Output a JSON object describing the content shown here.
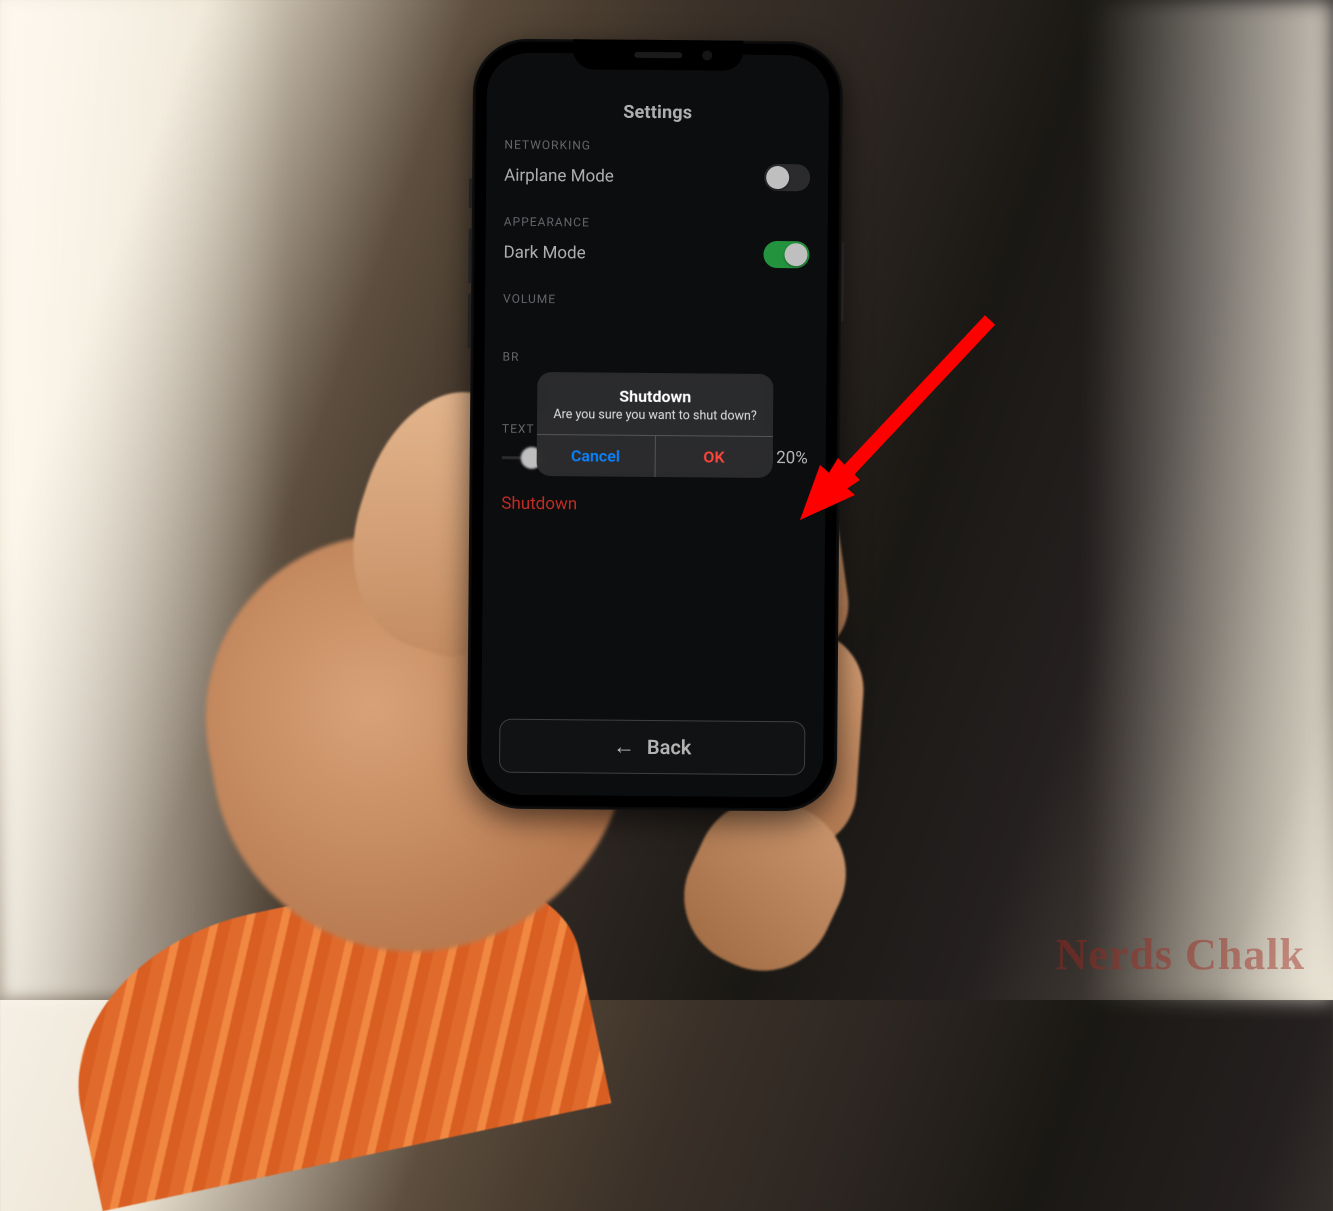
{
  "page_title": "Settings",
  "sections": {
    "networking": {
      "label": "NETWORKING",
      "item_label": "Airplane Mode",
      "toggle_on": false
    },
    "appearance": {
      "label": "APPEARANCE",
      "item_label": "Dark Mode",
      "toggle_on": true
    },
    "volume": {
      "label": "VOLUME"
    },
    "brightness": {
      "label_abbrev": "BR"
    },
    "text_size": {
      "label": "TEXT SIZE",
      "value_display": "120%",
      "slider_position_pct": 12
    }
  },
  "shutdown_link": "Shutdown",
  "back_button": "Back",
  "alert": {
    "title": "Shutdown",
    "message": "Are you sure you want to shut down?",
    "cancel": "Cancel",
    "ok": "OK"
  },
  "watermark": "Nerds Chalk",
  "colors": {
    "accent_blue": "#0a84ff",
    "destructive_red": "#ff453a",
    "toggle_green": "#30c552"
  }
}
